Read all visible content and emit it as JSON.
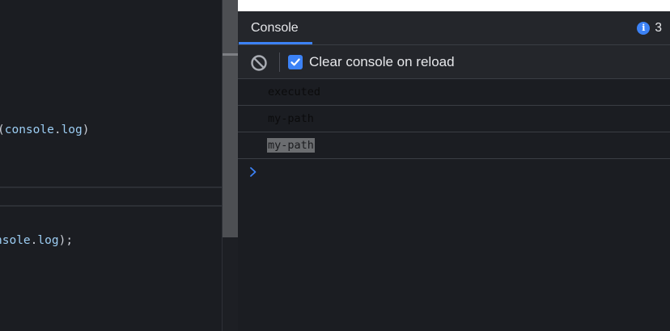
{
  "editor": {
    "line_1": {
      "prefix": "(",
      "object": "console",
      "dot": ".",
      "method": "log",
      "suffix": ")"
    },
    "line_2": {
      "object": "nsole",
      "dot": ".",
      "method": "log",
      "suffix": ");"
    }
  },
  "devtools": {
    "tabs": [
      {
        "label": "Console",
        "active": true
      }
    ],
    "issues_count": "3",
    "toolbar": {
      "clear_icon": "block-icon",
      "clear_on_reload_label": "Clear console on reload",
      "clear_on_reload_checked": true
    },
    "messages": [
      {
        "text": "executed"
      },
      {
        "text": "my-path"
      },
      {
        "text": "my-path"
      }
    ],
    "prompt_icon": "chevron-right-icon"
  },
  "colors": {
    "accent": "#3c82f6",
    "background": "#1b1d22",
    "panel": "#24262b",
    "code_identifier": "#9ccdf3"
  }
}
